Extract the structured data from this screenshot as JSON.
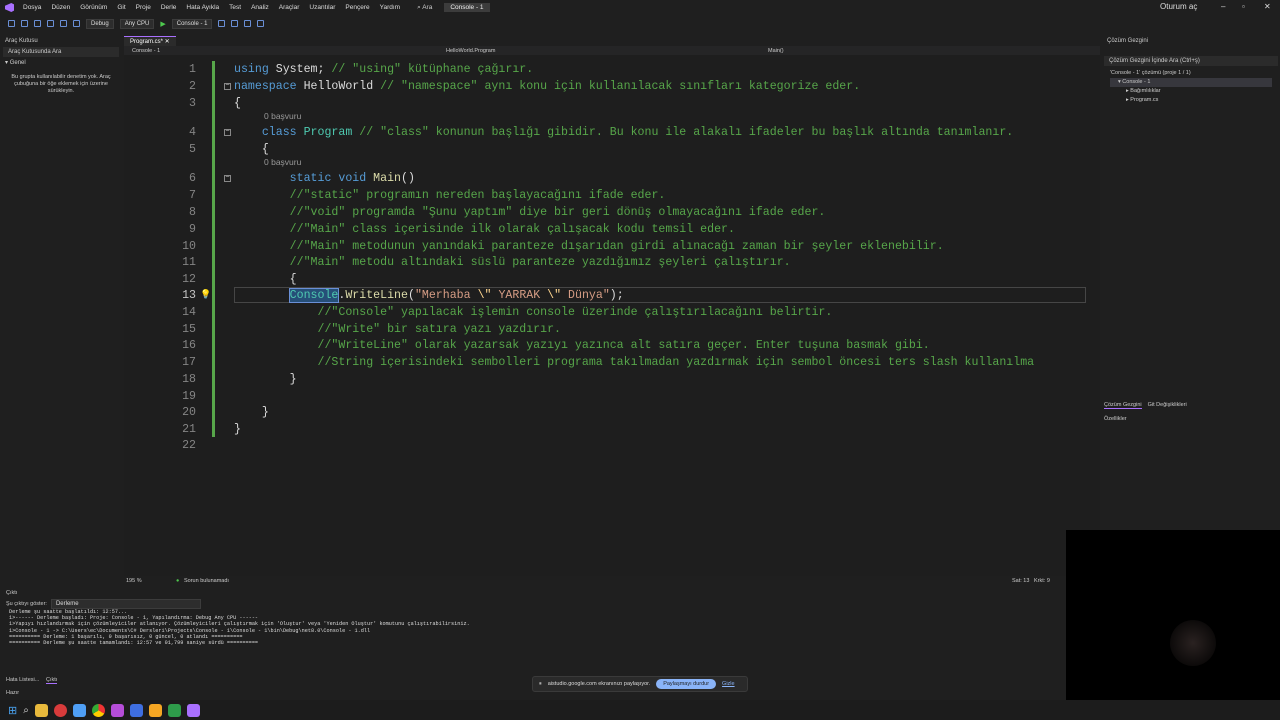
{
  "menu": {
    "items": [
      "Dosya",
      "Düzen",
      "Görünüm",
      "Git",
      "Proje",
      "Derle",
      "Hata Ayıkla",
      "Test",
      "Analiz",
      "Araçlar",
      "Uzantılar",
      "Pençere",
      "Yardım"
    ],
    "search": "Ara",
    "title_tag": "Console - 1",
    "signin": "Oturum aç"
  },
  "toolbar": {
    "config": "Debug",
    "platform": "Any CPU",
    "run_target": "Console - 1"
  },
  "left_panel": {
    "title": "Araç Kutusu",
    "search_placeholder": "Araç Kutusunda Ara",
    "group": "Genel",
    "empty_msg": "Bu grupta kullanılabilir denetim yok. Araç çubuğuna bir öğe eklemek için üzerine sürükleyin."
  },
  "editor": {
    "tab_label": "Program.cs*",
    "nav_project": "Console - 1",
    "nav_class": "HelloWorld.Program",
    "nav_member": "Main()",
    "references_label": "0 başvuru",
    "lines": [
      {
        "n": "1",
        "segs": [
          [
            "kw",
            "using "
          ],
          [
            "pl",
            "System; "
          ],
          [
            "cm",
            "// \"using\" kütüphane çağırır."
          ]
        ]
      },
      {
        "n": "2",
        "segs": [
          [
            "kw",
            "namespace "
          ],
          [
            "pl",
            "HelloWorld "
          ],
          [
            "cm",
            "// \"namespace\" aynı konu için kullanılacak sınıfları kategorize eder."
          ]
        ]
      },
      {
        "n": "3",
        "segs": [
          [
            "pl",
            "{"
          ]
        ]
      },
      {
        "n": "4",
        "segs": [
          [
            "pl",
            "    "
          ],
          [
            "kw",
            "class "
          ],
          [
            "ty",
            "Program "
          ],
          [
            "cm",
            "// \"class\" konunun başlığı gibidir. Bu konu ile alakalı ifadeler bu başlık altında tanımlanır."
          ]
        ]
      },
      {
        "n": "5",
        "segs": [
          [
            "pl",
            "    {"
          ]
        ]
      },
      {
        "n": "6",
        "segs": [
          [
            "pl",
            "        "
          ],
          [
            "kw",
            "static void "
          ],
          [
            "fn",
            "Main"
          ],
          [
            "pl",
            "()"
          ]
        ]
      },
      {
        "n": "7",
        "segs": [
          [
            "pl",
            "        "
          ],
          [
            "cm",
            "//\"static\" programın nereden başlayacağını ifade eder."
          ]
        ]
      },
      {
        "n": "8",
        "segs": [
          [
            "pl",
            "        "
          ],
          [
            "cm",
            "//\"void\" programda \"Şunu yaptım\" diye bir geri dönüş olmayacağını ifade eder."
          ]
        ]
      },
      {
        "n": "9",
        "segs": [
          [
            "pl",
            "        "
          ],
          [
            "cm",
            "//\"Main\" class içerisinde ilk olarak çalışacak kodu temsil eder."
          ]
        ]
      },
      {
        "n": "10",
        "segs": [
          [
            "pl",
            "        "
          ],
          [
            "cm",
            "//\"Main\" metodunun yanındaki paranteze dışarıdan girdi alınacağı zaman bir şeyler eklenebilir."
          ]
        ]
      },
      {
        "n": "11",
        "segs": [
          [
            "pl",
            "        "
          ],
          [
            "cm",
            "//\"Main\" metodu altındaki süslü paranteze yazdığımız şeyleri çalıştırır."
          ]
        ]
      },
      {
        "n": "12",
        "segs": [
          [
            "pl",
            "        {"
          ]
        ]
      },
      {
        "n": "13",
        "segs": [
          [
            "pl",
            "        "
          ],
          [
            "ty",
            "Console"
          ],
          [
            "pl",
            "."
          ],
          [
            "fn",
            "WriteLine"
          ],
          [
            "pl",
            "("
          ],
          [
            "st",
            "\"Merhaba "
          ],
          [
            "es",
            "\\\""
          ],
          [
            "st",
            " YARRAK "
          ],
          [
            "es",
            "\\\""
          ],
          [
            "st",
            " Dünya\""
          ],
          [
            "pl",
            ");"
          ]
        ]
      },
      {
        "n": "14",
        "segs": [
          [
            "pl",
            "            "
          ],
          [
            "cm",
            "//\"Console\" yapılacak işlemin console üzerinde çalıştırılacağını belirtir."
          ]
        ]
      },
      {
        "n": "15",
        "segs": [
          [
            "pl",
            "            "
          ],
          [
            "cm",
            "//\"Write\" bir satıra yazı yazdırır."
          ]
        ]
      },
      {
        "n": "16",
        "segs": [
          [
            "pl",
            "            "
          ],
          [
            "cm",
            "//\"WriteLine\" olarak yazarsak yazıyı yazınca alt satıra geçer. Enter tuşuna basmak gibi."
          ]
        ]
      },
      {
        "n": "17",
        "segs": [
          [
            "pl",
            "            "
          ],
          [
            "cm",
            "//String içerisindeki sembolleri programa takılmadan yazdırmak için sembol öncesi ters slash kullanılma"
          ]
        ]
      },
      {
        "n": "18",
        "segs": [
          [
            "pl",
            "        }"
          ]
        ]
      },
      {
        "n": "19",
        "segs": [
          [
            "pl",
            ""
          ]
        ]
      },
      {
        "n": "20",
        "segs": [
          [
            "pl",
            "    }"
          ]
        ]
      },
      {
        "n": "21",
        "segs": [
          [
            "pl",
            "}"
          ]
        ]
      },
      {
        "n": "22",
        "segs": [
          [
            "pl",
            ""
          ]
        ]
      }
    ]
  },
  "status_row": {
    "zoom": "195 %",
    "issues": "Sorun bulunamadı",
    "position": "Sat: 13",
    "char": "Krkt: 9"
  },
  "right_panel": {
    "title": "Çözüm Gezgini",
    "search_placeholder": "Çözüm Gezgini İçinde Ara (Ctrl+ş)",
    "solution": "'Console - 1' çözümü (proje 1 / 1)",
    "project": "Console - 1",
    "dependencies": "Bağımlılıklar",
    "file": "Program.cs",
    "tab_solution": "Çözüm Gezgini",
    "tab_git": "Git Değişiklikleri",
    "props_title": "Özellikler"
  },
  "output": {
    "title": "Çıktı",
    "show_from_label": "Şu çıktıyı göster:",
    "show_from_value": "Derleme",
    "text": "Derleme şu saatte başlatıldı: 12:57...\n1>------ Derleme başladı: Proje: Console - 1, Yapılandırma: Debug Any CPU ------\n1>Yapıyı hızlandırmak için çözümleyiciler atlanıyor. Çözümleyicileri çalıştırmak için 'Oluştur' veya 'Yeniden Oluştur' komutunu çalıştırabilirsiniz.\n1>Console - 1 -> C:\\Users\\ec\\Documents\\C# Dersleri\\Projects\\Console - 1\\Console - 1\\bin\\Debug\\net8.0\\Console - 1.dll\n========== Derleme: 1 başarılı, 0 başarısız, 0 güncel, 0 atlandı ==========\n========== Derleme şu saatte tamamlandı: 12:57 ve 01,799 saniye sürdü =========="
  },
  "bottom_tabs": [
    "Hata Listesi...",
    "Çıktı"
  ],
  "status_bar": {
    "ready": "Hazır"
  },
  "share_bar": {
    "message": "aistudio.google.com ekranınızı paylaşıyor.",
    "stop_label": "Paylaşmayı durdur",
    "hide_label": "Gizle"
  }
}
